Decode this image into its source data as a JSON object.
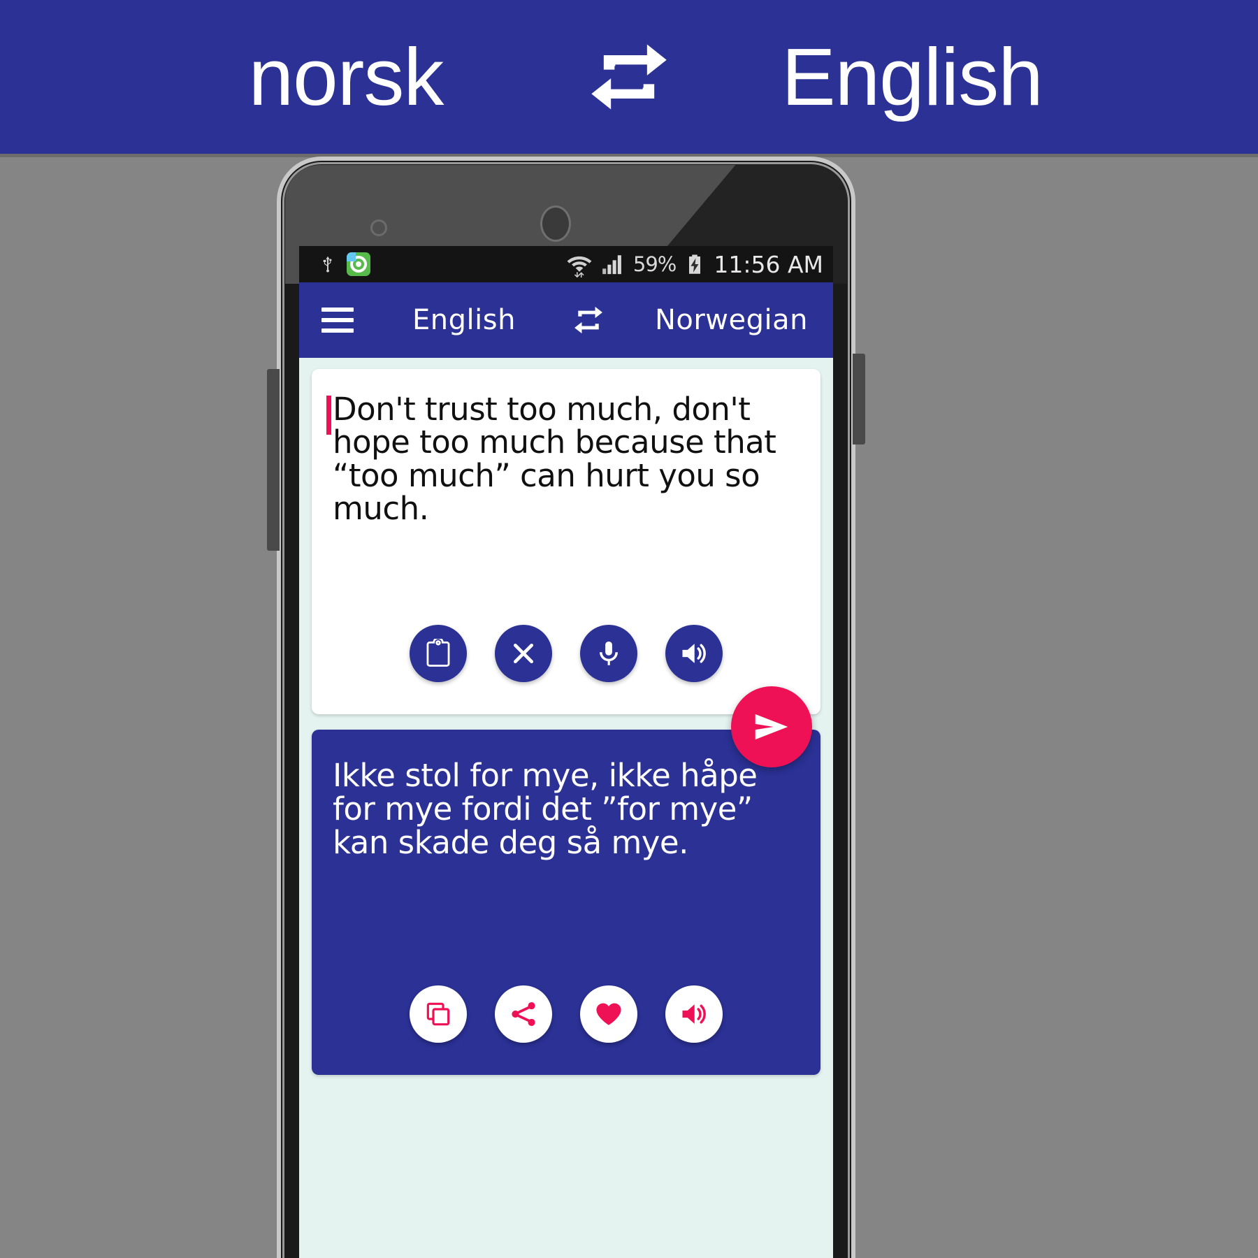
{
  "promo": {
    "left_language": "norsk",
    "swap_icon": "swap-horizontal-icon",
    "right_language": "English",
    "background_color": "#2b3195",
    "text_color": "#ffffff"
  },
  "device": {
    "kind": "android-phone-mockup",
    "side_buttons": [
      "volume-rocker",
      "power-button"
    ],
    "front_elements": [
      "proximity-sensor",
      "front-camera"
    ]
  },
  "status_bar": {
    "left_icons": [
      "usb-icon",
      "app-notification-icon"
    ],
    "right_icons": [
      "wifi-icon",
      "signal-icon",
      "battery-charging-icon"
    ],
    "battery_percent": "59%",
    "time": "11:56 AM",
    "background_color": "#141414"
  },
  "toolbar": {
    "menu_icon": "hamburger-menu-icon",
    "source_language": "English",
    "swap_icon": "swap-languages-icon",
    "target_language": "Norwegian",
    "background_color": "#2b3195"
  },
  "input_card": {
    "text": "Don't trust too much, don't hope too much because that “too much” can hurt you so much.",
    "caret_color": "#ef1155",
    "background_color": "#ffffff",
    "actions": [
      {
        "name": "paste-button",
        "icon": "clipboard-icon",
        "label": "Paste"
      },
      {
        "name": "clear-button",
        "icon": "close-x-icon",
        "label": "Clear"
      },
      {
        "name": "voice-input-button",
        "icon": "microphone-icon",
        "label": "Speak"
      },
      {
        "name": "speak-source-button",
        "icon": "speaker-icon",
        "label": "Listen"
      }
    ]
  },
  "send_button": {
    "name": "translate-send-button",
    "icon": "send-paper-plane-icon",
    "color": "#ef1155"
  },
  "output_card": {
    "text": "Ikke stol for mye, ikke håpe for mye fordi det ”for mye” kan skade deg så mye.",
    "background_color": "#2b3195",
    "text_color": "#ffffff",
    "actions": [
      {
        "name": "copy-button",
        "icon": "copy-icon",
        "label": "Copy"
      },
      {
        "name": "share-button",
        "icon": "share-icon",
        "label": "Share"
      },
      {
        "name": "favorite-button",
        "icon": "heart-icon",
        "label": "Favorite"
      },
      {
        "name": "speak-result-button",
        "icon": "speaker-icon",
        "label": "Listen"
      }
    ]
  }
}
